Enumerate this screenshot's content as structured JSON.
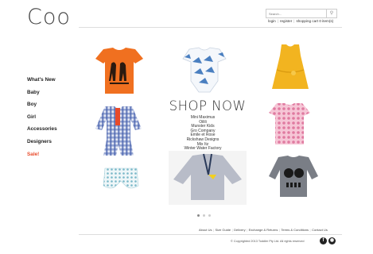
{
  "brand": {
    "logo": "Coo"
  },
  "search": {
    "placeholder": "Search..."
  },
  "account": {
    "login": "login",
    "register": "register",
    "cart": "shopping cart",
    "cart_count": "0 item(s)"
  },
  "nav": [
    "What's New",
    "Baby",
    "Boy",
    "Girl",
    "Accessories",
    "Designers",
    "Sale!"
  ],
  "hero": {
    "title": "SHOP NOW",
    "brands": [
      "Mini Maximus",
      "Oilili",
      "Munster Kids",
      "Gro Company",
      "Emile et Rose",
      "Rickshaw Designs",
      "Mix Itz",
      "Winter Water Factory"
    ]
  },
  "carousel": {
    "pages": 3,
    "active": 0
  },
  "footer": {
    "links": [
      "About Us",
      "Size Guide",
      "Delivery",
      "Exchange & Returns",
      "Terms & Conditions",
      "Contact Us"
    ],
    "copyright": "© Copyrighted 2013 Toddler Pty Ltd. All rights reserved",
    "social": [
      "facebook-icon",
      "camera-icon"
    ]
  },
  "colors": {
    "sale": "#e84a2a",
    "orange_tee": "#f07020",
    "yellow_dress": "#f2b420"
  }
}
